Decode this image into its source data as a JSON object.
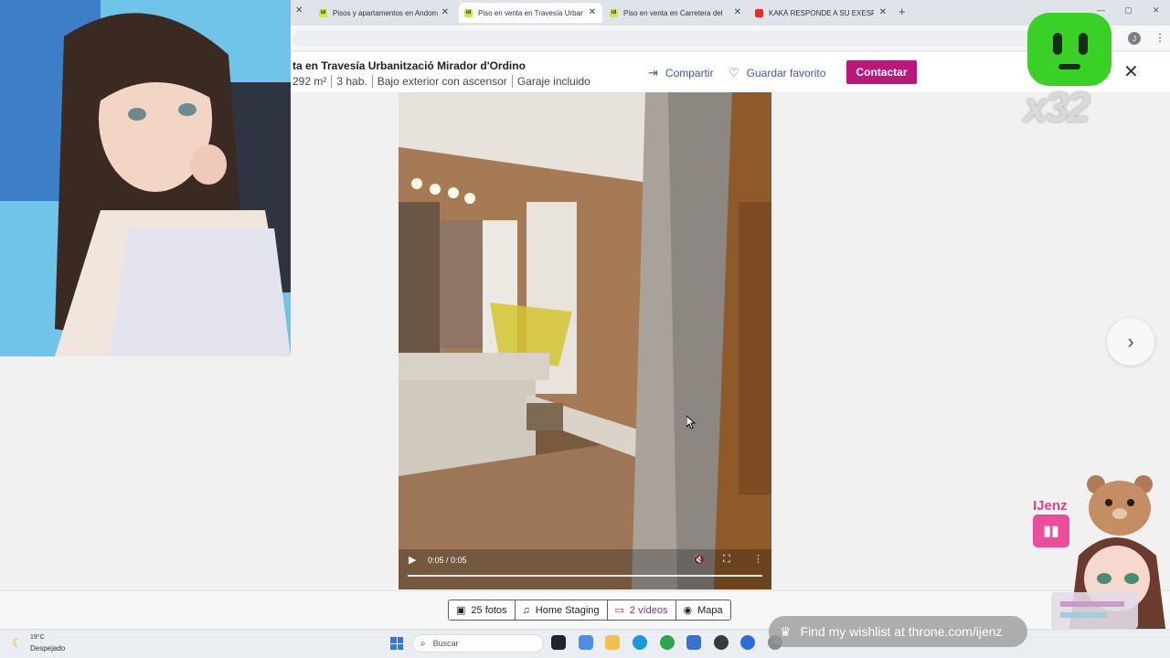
{
  "browser": {
    "tabs": [
      {
        "favicon": "idealista-favicon",
        "title": "Pisos y apartamentos en Andorra",
        "active": false
      },
      {
        "favicon": "idealista-favicon",
        "title": "Piso en venta en Travesía Urbanització",
        "active": true
      },
      {
        "favicon": "idealista-favicon",
        "title": "Piso en venta en Carretera del",
        "active": false
      },
      {
        "favicon": "youtube-favicon",
        "title": "KAKÁ RESPONDE A SU EXESPOSA",
        "active": false
      }
    ],
    "favicon_label": "id",
    "new_tab_label": "+",
    "close_label": "✕",
    "window_controls": {
      "minimize": "—",
      "maximize": "▢",
      "close": "✕"
    },
    "profile_initial": "J",
    "menu_label": "⋮"
  },
  "listing": {
    "title": "ta en Travesía Urbanització Mirador d'Ordino",
    "meta": [
      "292 m²",
      "3 hab.",
      "Bajo exterior con ascensor",
      "Garaje incluido"
    ],
    "share_label": "Compartir",
    "favorite_label": "Guardar favorito",
    "contact_label": "Contactar",
    "close_label": "✕",
    "accent_color": "#b7187a",
    "link_color": "#3f5b9b"
  },
  "video": {
    "time": "0:05 / 0:05",
    "progress": 1.0,
    "play_label": "▶",
    "mute_label": "🔇",
    "fullscreen_label": "⛶",
    "more_label": "⋮"
  },
  "gallery": {
    "next_label": "›",
    "tabs": [
      {
        "icon": "image-icon",
        "label": "25 fotos",
        "active": false
      },
      {
        "icon": "bell-icon",
        "label": "Home Staging",
        "active": false
      },
      {
        "icon": "video-icon",
        "label": "2 vídeos",
        "active": true
      },
      {
        "icon": "map-pin-icon",
        "label": "Mapa",
        "active": false
      }
    ]
  },
  "overlay": {
    "counter": "x32",
    "streamer": "IJenz",
    "wishlist": "Find my wishlist at throne.com/ijenz"
  },
  "taskbar": {
    "temperature": "19°C",
    "weather": "Despejado",
    "search_placeholder": "Buscar"
  }
}
